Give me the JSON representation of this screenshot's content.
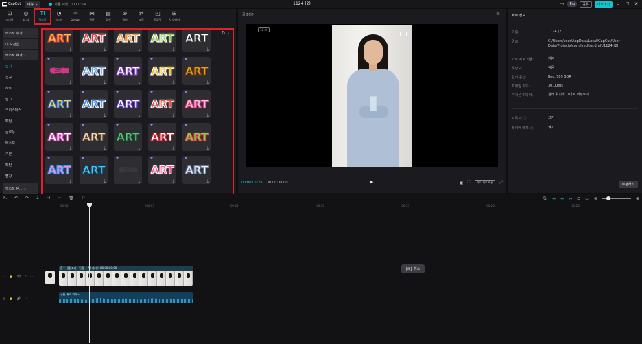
{
  "app": {
    "logo": "CapCut",
    "menu_label": "메뉴",
    "autosave": "자동 저장: 00:00:54",
    "title": "1124 (2)",
    "pro": "Pro",
    "share": "공유",
    "export": "내보내기"
  },
  "toolbar": [
    {
      "icon": "⊡",
      "label": "미디어",
      "name": "tool-media"
    },
    {
      "icon": "◎",
      "label": "오디오",
      "name": "tool-audio"
    },
    {
      "icon": "TI",
      "label": "텍스트",
      "name": "tool-text",
      "active": true
    },
    {
      "icon": "◔",
      "label": "스티커",
      "name": "tool-sticker"
    },
    {
      "icon": "✧",
      "label": "효과효과",
      "name": "tool-effects"
    },
    {
      "icon": "⋈",
      "label": "전환",
      "name": "tool-transition"
    },
    {
      "icon": "▤",
      "label": "캡션",
      "name": "tool-caption"
    },
    {
      "icon": "⊛",
      "label": "필터",
      "name": "tool-filter"
    },
    {
      "icon": "⇄",
      "label": "조정",
      "name": "tool-adjust"
    },
    {
      "icon": "◰",
      "label": "템플릿",
      "name": "tool-template"
    },
    {
      "icon": "⊞",
      "label": "AI 아바타",
      "name": "tool-ai-avatar"
    }
  ],
  "categories": [
    {
      "label": "텍스트 추가",
      "style": "box"
    },
    {
      "label": "내 보관함 ⌄",
      "style": "box"
    },
    {
      "label": "텍스트 효과 ⌄",
      "style": "box sub"
    },
    {
      "label": "인기",
      "style": "sel"
    },
    {
      "label": "신규",
      "style": ""
    },
    {
      "label": "하트",
      "style": ""
    },
    {
      "label": "발고",
      "style": ""
    },
    {
      "label": "크리스마스",
      "style": ""
    },
    {
      "label": "패턴",
      "style": ""
    },
    {
      "label": "글로우",
      "style": ""
    },
    {
      "label": "텍스쳐",
      "style": ""
    },
    {
      "label": "기본",
      "style": ""
    },
    {
      "label": "패턴",
      "style": ""
    },
    {
      "label": "빨강",
      "style": ""
    },
    {
      "label": "텍스트 템... ⌄",
      "style": "dropdown"
    }
  ],
  "grid": {
    "sort_label": "Tт ⌄",
    "tiles": [
      {
        "text": "ART",
        "fill": "#f0c040",
        "stroke": "#e23a3a",
        "small": false
      },
      {
        "text": "ART",
        "fill": "#e23a3a",
        "stroke": "#ffffff",
        "small": false
      },
      {
        "text": "ART",
        "fill": "#f29a3a",
        "stroke": "#ffffff",
        "small": false
      },
      {
        "text": "ART",
        "fill": "#8fd14f",
        "stroke": "#ffffff",
        "small": false
      },
      {
        "text": "ART",
        "fill": "#ffffff",
        "stroke": "#333333",
        "small": false
      },
      {
        "text": "워드아트",
        "fill": "#ffd23a",
        "stroke": "#d43a8a",
        "small": true
      },
      {
        "text": "ART",
        "fill": "#6aa8e8",
        "stroke": "#ffffff",
        "small": false
      },
      {
        "text": "ART",
        "fill": "#ffffff",
        "stroke": "#9a4ad8",
        "small": false
      },
      {
        "text": "ART",
        "fill": "#f0c020",
        "stroke": "#ffffff",
        "small": false
      },
      {
        "text": "ART",
        "fill": "#e8a020",
        "stroke": "#6a3a10",
        "small": false
      },
      {
        "text": "ART",
        "fill": "#ffd23a",
        "stroke": "#2a6ae0",
        "small": false
      },
      {
        "text": "ART",
        "fill": "#3a8ae8",
        "stroke": "#ffffff",
        "small": false
      },
      {
        "text": "ART",
        "fill": "#ffffff",
        "stroke": "#6a3ad8",
        "small": false
      },
      {
        "text": "ART",
        "fill": "#e84a4a",
        "stroke": "#ffffff",
        "small": false
      },
      {
        "text": "ART",
        "fill": "#ffc0d8",
        "stroke": "#e04a8a",
        "small": false
      },
      {
        "text": "ART",
        "fill": "#ffffff",
        "stroke": "#d84ab8",
        "small": false
      },
      {
        "text": "ART",
        "fill": "#f0d8c0",
        "stroke": "#6a4a30",
        "small": false
      },
      {
        "text": "ART",
        "fill": "#60c080",
        "stroke": "#1a4a2a",
        "small": false
      },
      {
        "text": "ART",
        "fill": "#ffffff",
        "stroke": "#e0202a",
        "small": false
      },
      {
        "text": "ART",
        "fill": "#7ad848",
        "stroke": "#e84a4a",
        "small": false
      },
      {
        "text": "ART",
        "fill": "#ff8ad0",
        "stroke": "#3aa0ff",
        "small": false
      },
      {
        "text": "ART",
        "fill": "#3ad0e8",
        "stroke": "#1a3a6a",
        "small": false
      },
      {
        "text": "워드아트",
        "fill": "#ffffff",
        "stroke": "#3a3a3a",
        "small": true
      },
      {
        "text": "ART",
        "fill": "#ff5aa0",
        "stroke": "#ffffff",
        "small": false
      },
      {
        "text": "ART",
        "fill": "#e8eef8",
        "stroke": "#6a7a9a",
        "small": false
      }
    ]
  },
  "player": {
    "title": "플레이어",
    "frame_label": "1C AI",
    "timecode_current": "00:00:01:26",
    "timecode_total": "00:00:08:00",
    "ratio_label": "가로 세로 비율"
  },
  "details": {
    "title": "세부 정보",
    "rows": [
      {
        "k": "이름:",
        "v": "1124 (2)"
      },
      {
        "k": "경로:",
        "v": "C:/Users/user/AppData/Local/CapCut/User Data/Projects/com.lveditor.draft/1124 (2)"
      },
      {
        "k": "가로 세로 비율:",
        "v": "원본"
      },
      {
        "k": "해상도:",
        "v": "적용"
      },
      {
        "k": "컬러 공간:",
        "v": "Rec. 709 SDR"
      },
      {
        "k": "프레임 속도:",
        "v": "30.00fps"
      },
      {
        "k": "가져온 미디어:",
        "v": "원래 위치에 그대로 머무르기"
      }
    ],
    "rows2": [
      {
        "k": "프록시: ⓘ",
        "v": "끄기"
      },
      {
        "k": "레이어 배치: ⓘ",
        "v": "켜기"
      }
    ],
    "modify": "수정하기"
  },
  "timeline": {
    "ruler": [
      "00:00",
      "|00:05",
      "00:05",
      "|00:10",
      "|00:15",
      "|00:20",
      "|00:25"
    ],
    "video_label": "흡수 정점표과 · 편집  ✧ AI 캐디어  00:00:08:00",
    "audio_label": "구름 위의 피아노",
    "tooltip": "취소"
  }
}
